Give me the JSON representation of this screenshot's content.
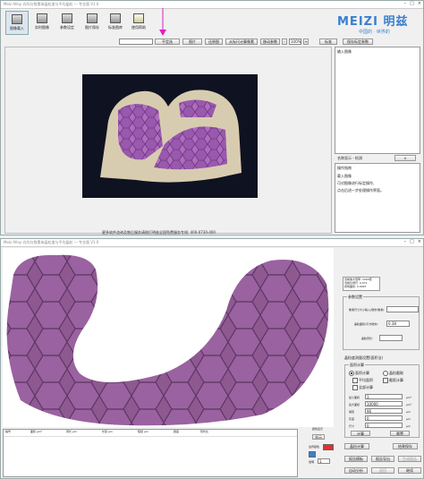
{
  "top": {
    "title": "Meiz Alloy 向均匀铁素体晶粒度与平均晶粒 — 专业版 V1.0",
    "toolbar": [
      "图像载入",
      "实时图像",
      "参数设定",
      "图片保存",
      "标准图库",
      "使用帮助"
    ],
    "brand_main": "MEIZI 明兹",
    "brand_sub": "中国的 · 世界的",
    "ctrl": {
      "mode_btn": "平定选",
      "scale": "图片",
      "reset": "还原图",
      "load_cal": "从标尺计算像素",
      "adjust": "移动参数",
      "zoom_val": "100%",
      "confirm": "标准",
      "save_cal": "保存标定参数"
    },
    "right_header": "输入图像",
    "grid_label": "名称显示 - 检测",
    "op_title": "操作指南",
    "op_lines": [
      "载入图像",
      "可对图像进行标定操作,",
      "点击后进一步处理操作界面。"
    ],
    "footer": "更多软件咨询及售后服务请拨打明兹全国免费服务专线: 400-0730-400"
  },
  "bottom": {
    "title": "Meiz Alloy 向均匀铁素体晶粒度与平均晶粒 — 专业版 V1.0",
    "info": [
      "当前放大倍率: 1000倍",
      "当前比例尺: 0.071",
      "视场面积: 0.0097"
    ],
    "params_title": "参数设置",
    "params": [
      {
        "label": "像素尺寸大小输入(微米/像素):",
        "value": ""
      },
      {
        "label": "晶粒面积(平方微米):",
        "value": "0.38"
      },
      {
        "label": "晶粒周长:",
        "value": ""
      }
    ],
    "analysis_title": "晶粒度测量设置(面积法)",
    "grain_group": "面积计算",
    "opts": [
      "面积计算",
      "晶粒截取",
      "平均面积",
      "截距计算",
      "全部计算"
    ],
    "fields": [
      {
        "label": "最小面积",
        "value": "1",
        "unit": "μm²"
      },
      {
        "label": "最大面积",
        "value": "10000",
        "unit": "μm²"
      },
      {
        "label": "阈值",
        "value": "96",
        "unit": "μm"
      },
      {
        "label": "灰度",
        "value": "0",
        "unit": "μm"
      },
      {
        "label": "尺寸",
        "value": "0",
        "unit": "μm"
      }
    ],
    "btn_a": "计算",
    "btn_b": "重置",
    "calc": "晶粒计算",
    "export": "结果保存",
    "table_headers": [
      "编号",
      "面积 μm²",
      "周长 μm",
      "长径 μm",
      "短径 μm",
      "圆度",
      "形状比"
    ],
    "color_label": "颜色显示",
    "display": "显示",
    "speed_label": "边界颜色",
    "alpha_label": "透明",
    "alpha_value": "1",
    "bottom_btns": [
      "报告模板",
      "报告导出",
      "生成报告",
      "自动分析",
      "返回",
      "继续"
    ]
  }
}
